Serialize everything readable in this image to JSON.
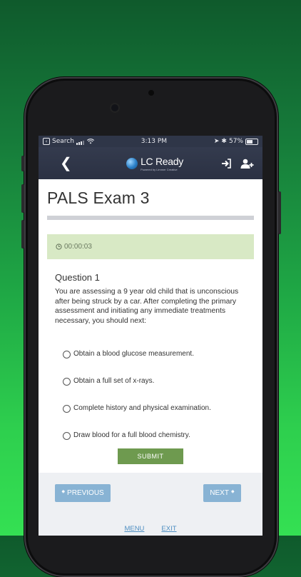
{
  "status_bar": {
    "back_app": "Search",
    "time": "3:13 PM",
    "battery": "57%",
    "battery_level": 0.57
  },
  "navbar": {
    "logo_text": "LC Ready",
    "logo_subtext": "Powered by Limmer Creative"
  },
  "exam": {
    "title": "PALS Exam 3",
    "timer": "00:00:03",
    "question_heading": "Question 1",
    "question_text": "You are assessing a 9 year old child that is unconscious after being struck by a car. After completing the primary assessment and initiating any immediate treatments necessary, you should next:",
    "options": [
      "Obtain a blood glucose measurement.",
      "Obtain a full set of x-rays.",
      "Complete history and physical examination.",
      "Draw blood for a full blood chemistry."
    ],
    "submit_label": "SUBMIT"
  },
  "pager": {
    "previous_label": "PREVIOUS",
    "next_label": "NEXT"
  },
  "footer": {
    "menu_label": "MENU",
    "exit_label": "EXIT"
  },
  "colors": {
    "navbar": "#2f3648",
    "timer_bg": "#d8e9c5",
    "submit_bg": "#6e9a4f",
    "pager_bg": "#88b3d4",
    "link": "#4f8fc2"
  }
}
